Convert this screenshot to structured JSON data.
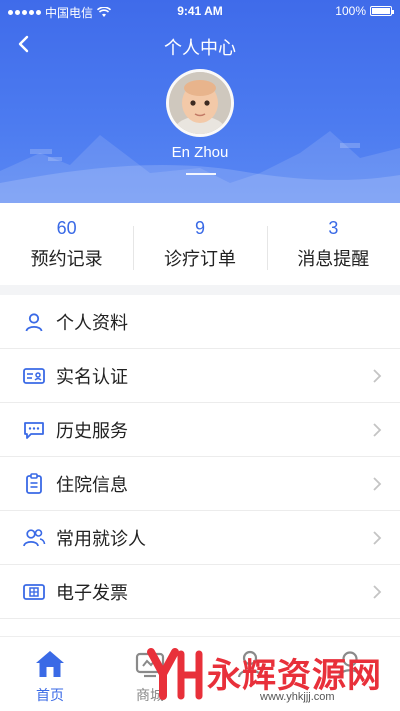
{
  "status_bar": {
    "carrier": "中国电信",
    "time": "9:41 AM",
    "battery": "100%",
    "battery_level": 1.0
  },
  "nav": {
    "title": "个人中心",
    "back_icon": "chevron-left-icon"
  },
  "profile": {
    "name": "En Zhou"
  },
  "stats": [
    {
      "value": "60",
      "label": "预约记录"
    },
    {
      "value": "9",
      "label": "诊疗订单"
    },
    {
      "value": "3",
      "label": "消息提醒"
    }
  ],
  "menu": [
    {
      "label": "个人资料",
      "icon": "user-icon",
      "chevron": false
    },
    {
      "label": "实名认证",
      "icon": "id-card-icon",
      "chevron": true
    },
    {
      "label": "历史服务",
      "icon": "chat-icon",
      "chevron": true
    },
    {
      "label": "住院信息",
      "icon": "clipboard-icon",
      "chevron": true
    },
    {
      "label": "常用就诊人",
      "icon": "users-icon",
      "chevron": true
    },
    {
      "label": "电子发票",
      "icon": "invoice-icon",
      "chevron": true
    }
  ],
  "tabs": [
    {
      "label": "首页",
      "icon": "home-icon",
      "active": true
    },
    {
      "label": "商城",
      "icon": "shop-icon",
      "active": false
    },
    {
      "label": "",
      "icon": "doctor-icon",
      "active": false
    },
    {
      "label": "",
      "icon": "profile-icon",
      "active": false
    }
  ],
  "watermark": {
    "text": "永辉资源网",
    "url": "www.yhkjjj.com"
  },
  "colors": {
    "primary": "#3a6ae6",
    "header": "#4c7bf0",
    "watermark": "#e8303a"
  }
}
